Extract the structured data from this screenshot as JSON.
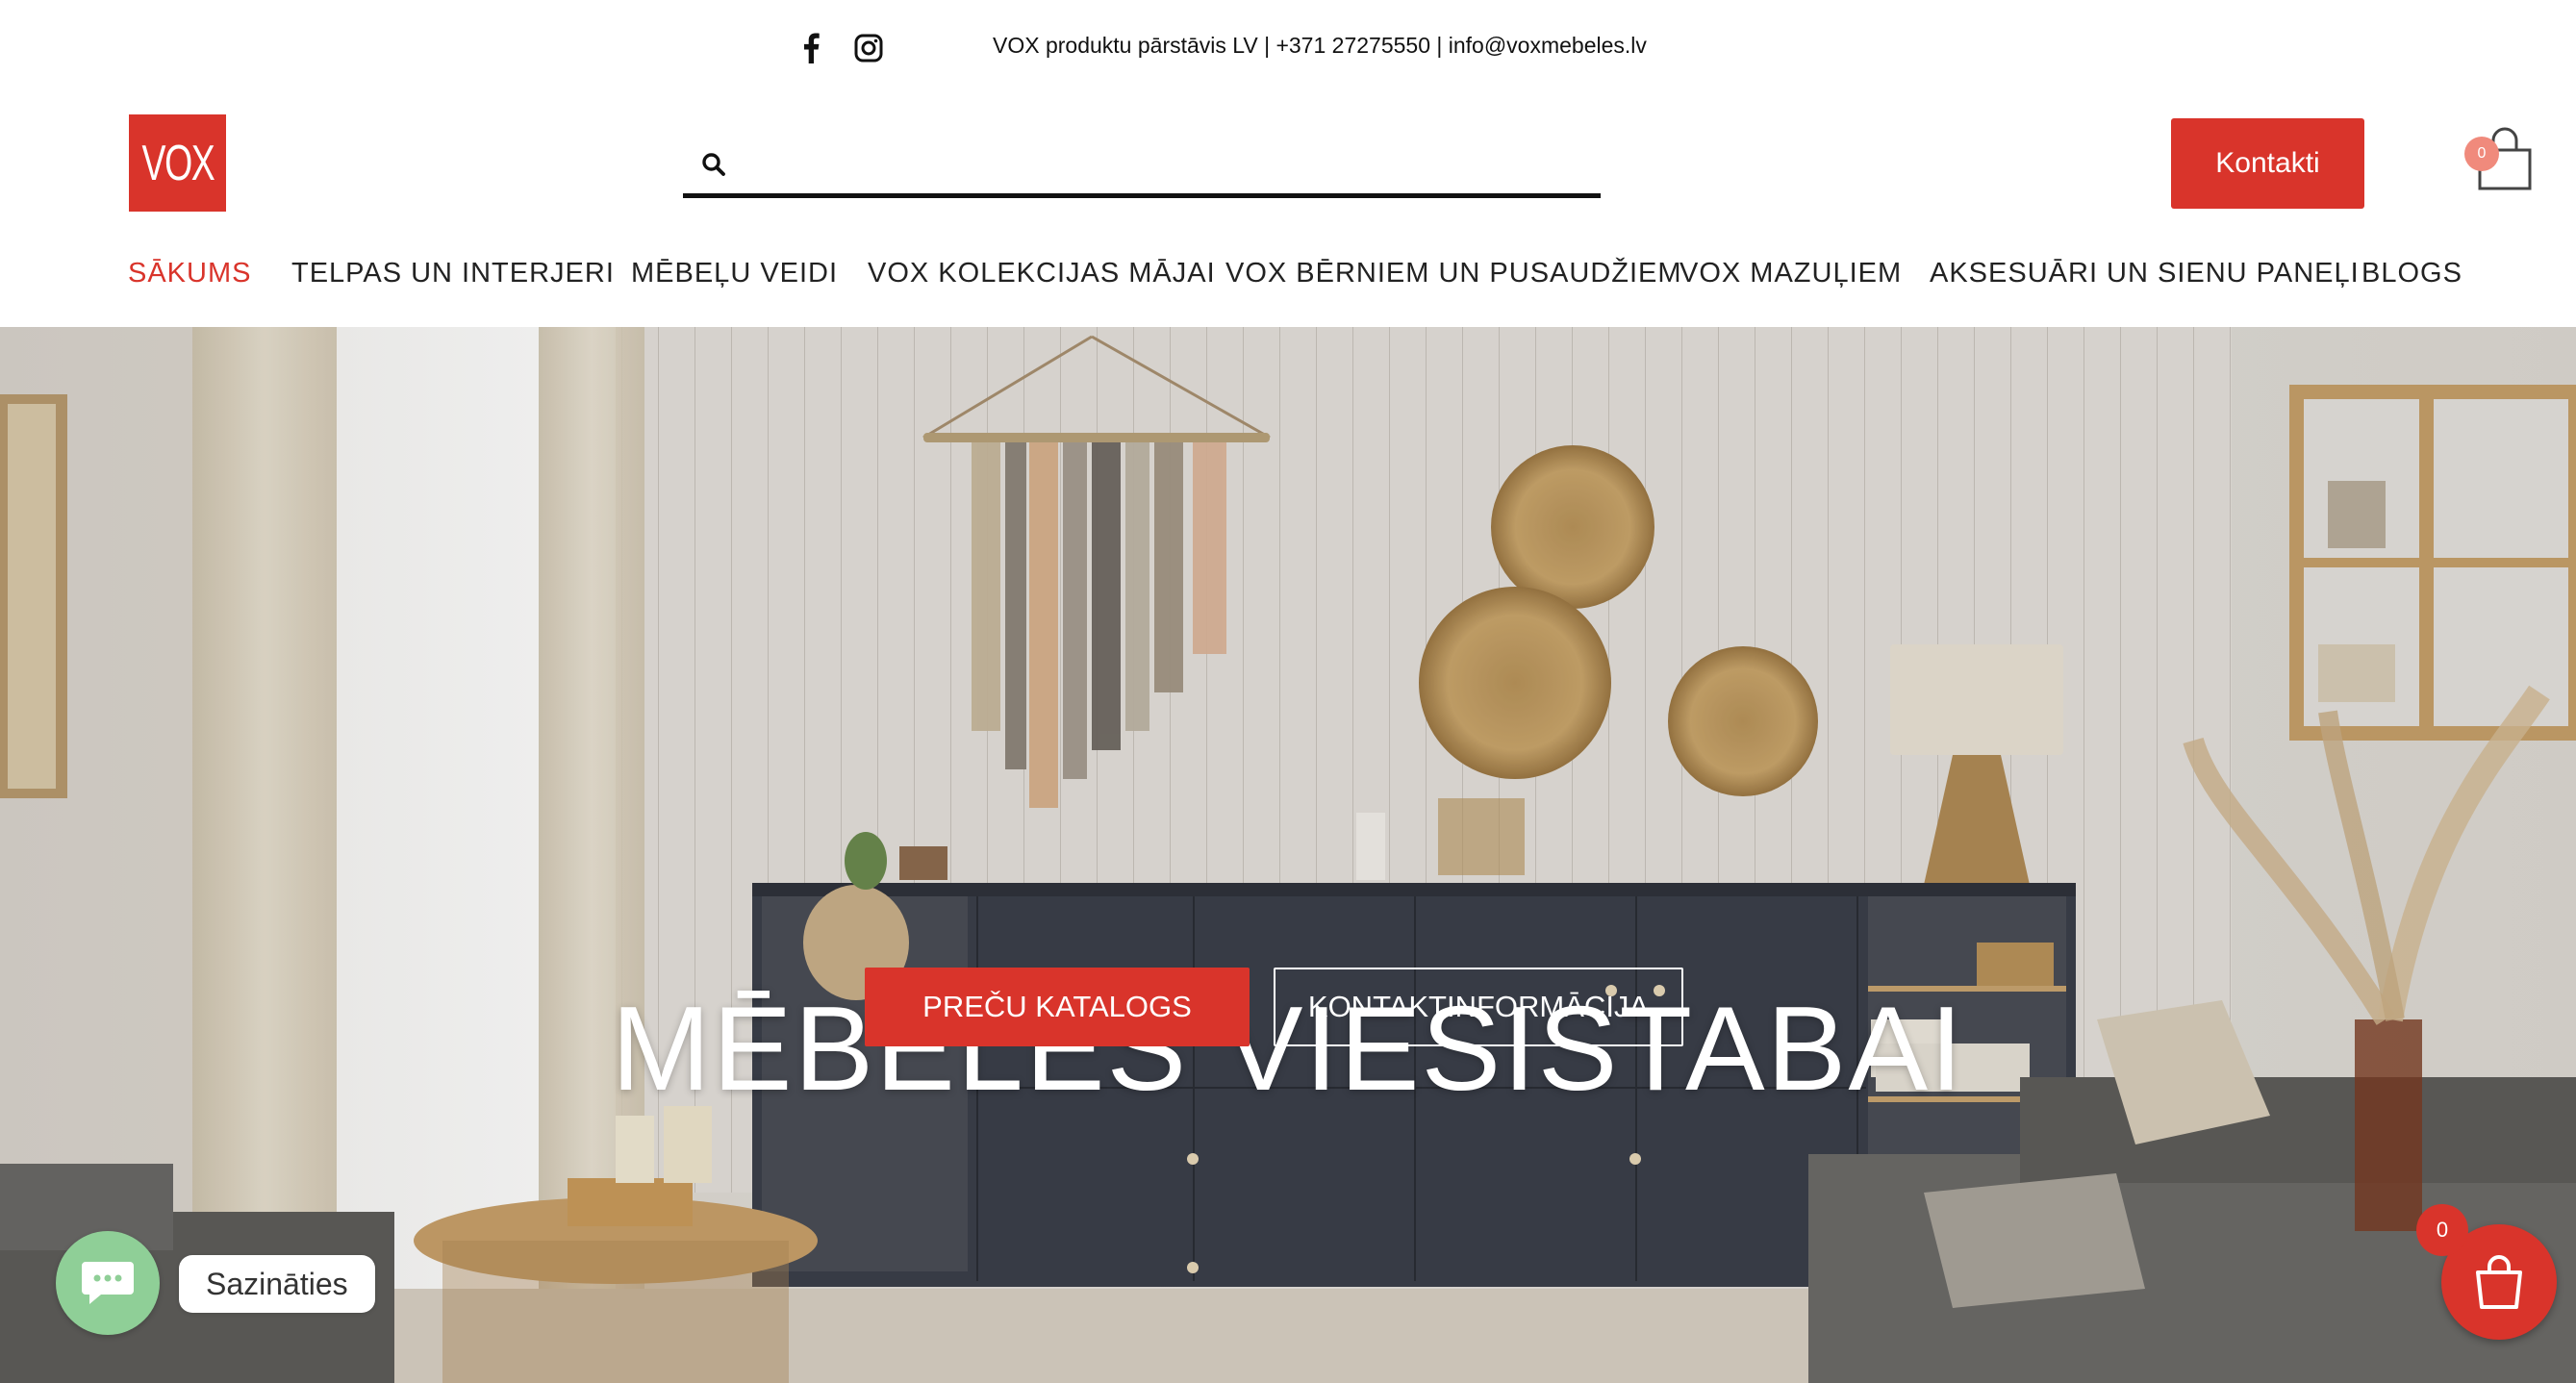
{
  "topbar": {
    "contact_line": "VOX produktu pārstāvis LV | +371 27275550 | info@voxmebeles.lv",
    "social_icons": [
      "facebook-icon",
      "instagram-icon"
    ]
  },
  "header": {
    "logo_text": "VOX",
    "search_placeholder": "",
    "contact_button": "Kontakti",
    "cart_count": "0"
  },
  "nav": {
    "items": [
      {
        "label": "SĀKUMS",
        "active": true
      },
      {
        "label": "TELPAS UN INTERJERI",
        "active": false
      },
      {
        "label": "MĒBEĻU VEIDI",
        "active": false
      },
      {
        "label": "VOX KOLEKCIJAS MĀJAI",
        "active": false
      },
      {
        "label": "VOX BĒRNIEM UN PUSAUDŽIEM",
        "active": false
      },
      {
        "label": "VOX MAZUĻIEM",
        "active": false
      },
      {
        "label": "AKSESUĀRI UN SIENU PANEĻI",
        "active": false
      },
      {
        "label": "BLOGS",
        "active": false
      }
    ]
  },
  "hero": {
    "title": "MĒBELES VIESISTABAI",
    "primary_button": "PREČU KATALOGS",
    "secondary_button": "KONTAKTINFORMĀCIJA"
  },
  "widgets": {
    "chat_label": "Sazināties",
    "cart_count": "0"
  },
  "colors": {
    "brand_red": "#d9342b",
    "chat_green": "#8fcf97",
    "badge_pink": "#f08a7c"
  }
}
